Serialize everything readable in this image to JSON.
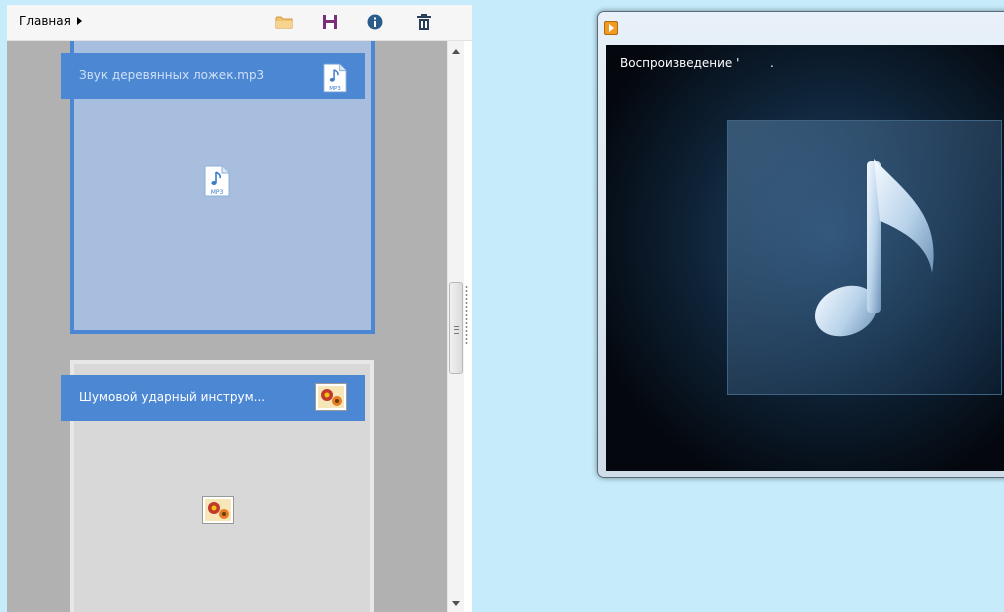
{
  "toolbar": {
    "breadcrumb": "Главная",
    "icons": [
      "folder-icon",
      "save-icon",
      "info-icon",
      "delete-icon"
    ]
  },
  "files": [
    {
      "name": "Звук деревянных ложек.mp3",
      "type": "mp3",
      "selected": true
    },
    {
      "name": "Шумовой  ударный  инструм...",
      "type": "image",
      "selected": false
    }
  ],
  "player": {
    "status_text": "Воспроизведение '        ."
  },
  "colors": {
    "selection": "#4c87d4",
    "panel_bg": "#b1b1b1",
    "desktop_bg": "#c6ecfb",
    "player_bg": "#0e2236"
  }
}
